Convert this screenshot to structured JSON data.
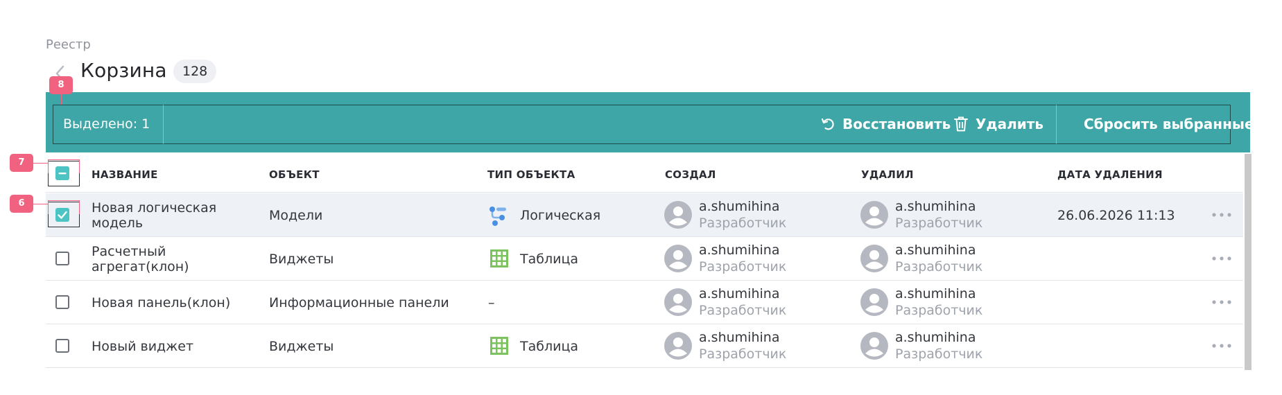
{
  "header": {
    "breadcrumb": "Реестр",
    "title": "Корзина",
    "count": "128"
  },
  "selection_bar": {
    "selected_text": "Выделено: 1",
    "restore_label": "Восстановить",
    "delete_label": "Удалить",
    "reset_label": "Сбросить выбранные",
    "background_color": "#3ea6a6"
  },
  "table": {
    "columns": {
      "name": "НАЗВАНИЕ",
      "object": "ОБЪЕКТ",
      "object_type": "ТИП ОБЪЕКТА",
      "created_by": "СОЗДАЛ",
      "deleted_by": "УДАЛИЛ",
      "deleted_at": "ДАТА УДАЛЕНИЯ"
    },
    "rows": [
      {
        "checked": true,
        "name_line1": "Новая логическая",
        "name_line2": "модель",
        "object": "Модели",
        "type_icon": "logical-model-icon",
        "type": "Логическая",
        "created_user": "a.shumihina",
        "created_role": "Разработчик",
        "deleted_user": "a.shumihina",
        "deleted_role": "Разработчик",
        "deleted_at": "26.06.2026 11:13"
      },
      {
        "checked": false,
        "name_line1": "Расчетный",
        "name_line2": "агрегат(клон)",
        "object": "Виджеты",
        "type_icon": "table-icon",
        "type": "Таблица",
        "created_user": "a.shumihina",
        "created_role": "Разработчик",
        "deleted_user": "a.shumihina",
        "deleted_role": "Разработчик",
        "deleted_at": ""
      },
      {
        "checked": false,
        "name_line1": "Новая панель(клон)",
        "name_line2": "",
        "object": "Информационные панели",
        "type_icon": "",
        "type": "–",
        "created_user": "a.shumihina",
        "created_role": "Разработчик",
        "deleted_user": "a.shumihina",
        "deleted_role": "Разработчик",
        "deleted_at": ""
      },
      {
        "checked": false,
        "name_line1": "Новый виджет",
        "name_line2": "",
        "object": "Виджеты",
        "type_icon": "table-icon",
        "type": "Таблица",
        "created_user": "a.shumihina",
        "created_role": "Разработчик",
        "deleted_user": "a.shumihina",
        "deleted_role": "Разработчик",
        "deleted_at": ""
      }
    ]
  },
  "annotations": {
    "marker_8": "8",
    "marker_7": "7",
    "marker_6": "6",
    "color": "#f0627f"
  }
}
